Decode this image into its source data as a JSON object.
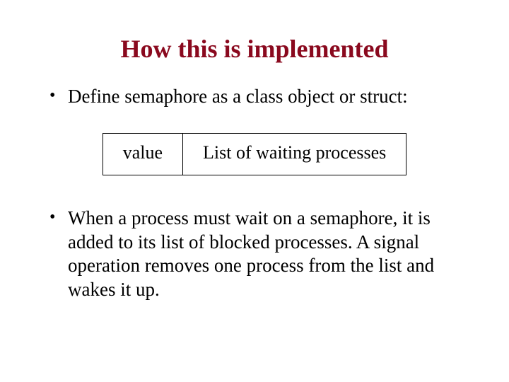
{
  "title_color": "#8a091e",
  "title": "How this is implemented",
  "bullet1": "Define semaphore as a class object or struct:",
  "diagram": {
    "left": "value",
    "right": "List of waiting processes"
  },
  "bullet2": "When a process must wait on a semaphore, it is added to its list of blocked processes. A signal operation removes one process from the list and wakes it up."
}
